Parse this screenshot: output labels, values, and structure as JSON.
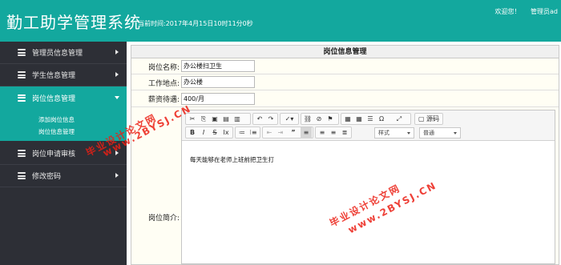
{
  "header": {
    "title": "勤工助学管理系统",
    "current_time": "当前时间:2017年4月15日10时11分0秒",
    "welcome": "欢迎您！",
    "user": "管理员ad"
  },
  "sidebar": {
    "items": [
      {
        "label": "管理员信息管理"
      },
      {
        "label": "学生信息管理"
      },
      {
        "label": "岗位信息管理"
      },
      {
        "label": "岗位申请审核"
      },
      {
        "label": "修改密码"
      }
    ],
    "subitems": [
      {
        "label": "添加岗位信息"
      },
      {
        "label": "岗位信息管理"
      }
    ]
  },
  "panel": {
    "title": "岗位信息管理",
    "fields": {
      "name_label": "岗位名称:",
      "name_value": "办公楼扫卫生",
      "location_label": "工作地点:",
      "location_value": "办公楼",
      "salary_label": "薪资待遇:",
      "salary_value": "400/月",
      "intro_label": "岗位简介:"
    },
    "editor": {
      "source_label": "源码",
      "style_label": "样式",
      "format_label": "普通",
      "content": "每天能够在老师上班前把卫生打"
    }
  },
  "watermark": {
    "text1": "毕业设计论文网",
    "url1": "www.2BYSJ.CN",
    "text2": "毕业设计论文网",
    "url2": "www.2BYSJ.CN"
  },
  "colors": {
    "accent": "#13a89e",
    "sidebar_bg": "#2d2f36",
    "watermark": "#eb1e14"
  }
}
